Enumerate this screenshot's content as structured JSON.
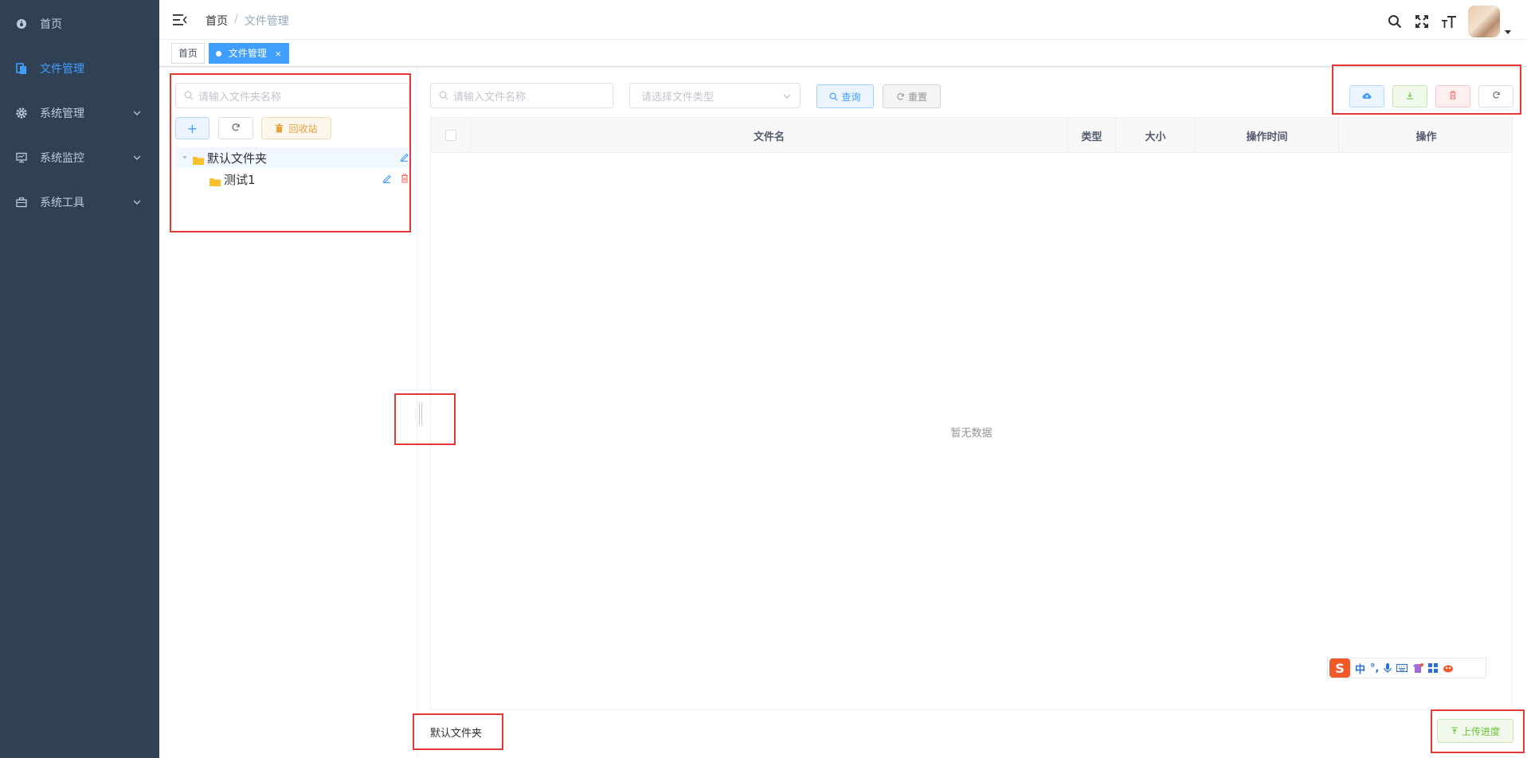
{
  "sidebar": {
    "items": [
      {
        "label": "首页",
        "icon": "dashboard-icon",
        "active": false,
        "has_children": false
      },
      {
        "label": "文件管理",
        "icon": "file-icon",
        "active": true,
        "has_children": false
      },
      {
        "label": "系统管理",
        "icon": "gear-icon",
        "active": false,
        "has_children": true
      },
      {
        "label": "系统监控",
        "icon": "monitor-icon",
        "active": false,
        "has_children": true
      },
      {
        "label": "系统工具",
        "icon": "toolbox-icon",
        "active": false,
        "has_children": true
      }
    ]
  },
  "navbar": {
    "breadcrumb": {
      "home": "首页",
      "separator": "/",
      "current": "文件管理"
    },
    "icons": [
      "search-icon",
      "fullscreen-icon",
      "font-size-icon"
    ]
  },
  "tags": [
    {
      "label": "首页",
      "active": false
    },
    {
      "label": "文件管理",
      "active": true,
      "close": "×"
    }
  ],
  "folder_panel": {
    "search_placeholder": "请输入文件夹名称",
    "add_button": "+",
    "refresh_icon": "refresh-icon",
    "recycle_label": "回收站",
    "tree": [
      {
        "label": "默认文件夹",
        "level": 0,
        "expanded": true,
        "selected": true
      },
      {
        "label": "测试1",
        "level": 1
      }
    ]
  },
  "toolbar": {
    "file_search_placeholder": "请输入文件名称",
    "file_type_placeholder": "请选择文件类型",
    "query_label": "查询",
    "reset_label": "重置"
  },
  "table": {
    "columns": [
      "文件名",
      "类型",
      "大小",
      "操作时间",
      "操作"
    ],
    "empty_text": "暂无数据"
  },
  "ime": {
    "logo": "S",
    "mode": "中",
    "punct": "°,"
  },
  "footer": {
    "current_folder": "默认文件夹",
    "upload_progress_label": "上传进度"
  },
  "colors": {
    "sidebar_bg": "#304156",
    "primary": "#409eff",
    "success": "#67c23a",
    "danger": "#f56c6c",
    "warning": "#e6a23c",
    "annotation_red": "#e53935"
  }
}
